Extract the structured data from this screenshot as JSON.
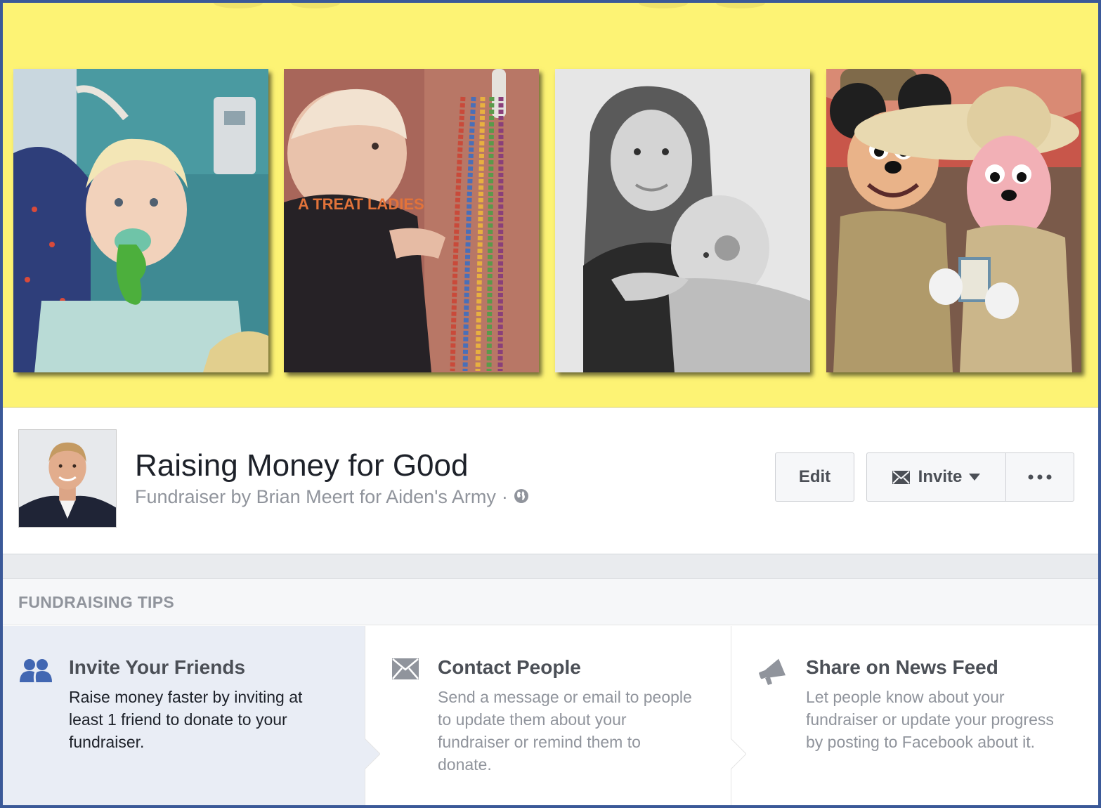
{
  "cover": {
    "background_color": "#fdf374",
    "photos": [
      {
        "name": "toddler-with-pacifier"
      },
      {
        "name": "boy-with-beads"
      },
      {
        "name": "mother-hugging-child"
      },
      {
        "name": "mickey-and-minnie"
      }
    ],
    "photo2_shirt_text": "A TREAT LADIES"
  },
  "header": {
    "title": "Raising Money for G0od",
    "subtitle": "Fundraiser by Brian Meert for Aiden's Army",
    "separator": "·",
    "privacy_icon": "globe-icon"
  },
  "actions": {
    "edit_label": "Edit",
    "invite_label": "Invite",
    "invite_icon": "envelope-icon",
    "more_icon": "ellipsis-icon"
  },
  "tips": {
    "title": "FUNDRAISING TIPS",
    "items": [
      {
        "icon": "friends-icon",
        "heading": "Invite Your Friends",
        "text": "Raise money faster by inviting at least 1 friend to donate to your fundraiser."
      },
      {
        "icon": "envelope-icon",
        "heading": "Contact People",
        "text": "Send a message or email to people to update them about your fundraiser or remind them to donate."
      },
      {
        "icon": "megaphone-icon",
        "heading": "Share on News Feed",
        "text": "Let people know about your fundraiser or update your progress by posting to Facebook about it."
      }
    ]
  },
  "colors": {
    "frame_border": "#3b5998",
    "cover_yellow": "#fdf374",
    "active_tip_bg": "#e9edf5",
    "secondary_text": "#90949c"
  }
}
